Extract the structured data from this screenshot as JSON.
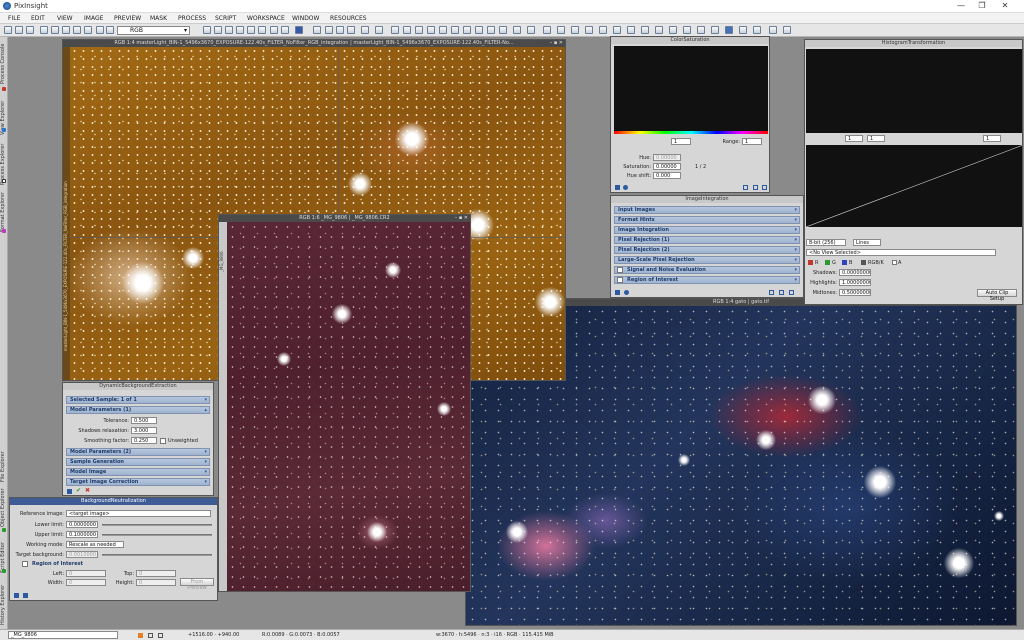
{
  "app": {
    "title": "PixInsight"
  },
  "window_controls": {
    "minimize": "—",
    "maximize": "❐",
    "close": "✕"
  },
  "menu": [
    "FILE",
    "EDIT",
    "VIEW",
    "IMAGE",
    "PREVIEW",
    "MASK",
    "PROCESS",
    "SCRIPT",
    "WORKSPACE",
    "WINDOW",
    "RESOURCES"
  ],
  "toolbar": {
    "rgb_mode": "RGB"
  },
  "side_tabs": [
    "Process Console",
    "View Explorer",
    "Process Explorer",
    "Format Explorer",
    "File Explorer",
    "Object Explorer",
    "Script Editor",
    "History Explorer"
  ],
  "windows": {
    "master": {
      "title": "RGB 1:4 masterLight_BIN-1_5496x3670_EXPOSURE-122.40s_FILTER_NoFilter_RGB_integration | masterLight_BIN-1_5496x3670_EXPOSURE-122.40s_FILTER-No...",
      "side_label": "masterLight_BIN-1_5496x3670_EXPOSURE-122.40s_FILTER_NoFilter_RGB_integration"
    },
    "mg": {
      "title": "RGB 1:6 _MG_9806 | _MG_9806.CR2",
      "side_label": "_MG_9806"
    },
    "gato": {
      "title": "RGB 1:4 gato | gato.tif",
      "side_label": "gato"
    }
  },
  "color_saturation": {
    "title": "ColorSaturation",
    "zoom": "1",
    "range_label": "Range:",
    "range_value": "1",
    "hue_label": "Hue:",
    "hue_value": "0.00000",
    "saturation_label": "Saturation:",
    "saturation_value": "0.00000",
    "page": "1 / 2",
    "hue_shift_label": "Hue shift:",
    "hue_shift_value": "0.000"
  },
  "histogram": {
    "title": "HistogramTransformation",
    "zoom1": "1",
    "zoom2": "1",
    "zoom3": "1",
    "bits": "8-bit (256)",
    "mode": "Lines",
    "view": "<No View Selected>",
    "channels": [
      "R",
      "G",
      "B",
      "RGB/K",
      "A"
    ],
    "shadows_label": "Shadows:",
    "shadows_value": "0.00000000",
    "highlights_label": "Highlights:",
    "highlights_value": "1.00000000",
    "midtones_label": "Midtones:",
    "midtones_value": "0.50000000",
    "auto_clip": "Auto Clip Setup"
  },
  "image_integration": {
    "title": "ImageIntegration",
    "sections": [
      "Input Images",
      "Format Hints",
      "Image Integration",
      "Pixel Rejection (1)",
      "Pixel Rejection (2)",
      "Large-Scale Pixel Rejection",
      "Signal and Noise Evaluation",
      "Region of Interest"
    ]
  },
  "dbe": {
    "title": "DynamicBackgroundExtraction",
    "sections_top": [
      "Selected Sample: 1 of 1",
      "Model Parameters (1)"
    ],
    "tolerance_label": "Tolerance:",
    "tolerance_value": "0.500",
    "shadows_relax_label": "Shadows relaxation:",
    "shadows_relax_value": "3.000",
    "smoothing_label": "Smoothing factor:",
    "smoothing_value": "0.250",
    "unweighted_label": "Unweighted",
    "sections_bottom": [
      "Model Parameters (2)",
      "Sample Generation",
      "Model Image",
      "Target Image Correction"
    ]
  },
  "bn": {
    "title": "BackgroundNeutralization",
    "ref_label": "Reference image:",
    "ref_value": "<target image>",
    "lower_label": "Lower limit:",
    "lower_value": "0.0000000",
    "upper_label": "Upper limit:",
    "upper_value": "0.1000000",
    "mode_label": "Working mode:",
    "mode_value": "Rescale as needed",
    "target_bg_label": "Target background:",
    "target_bg_value": "0.0010000",
    "roi_label": "Region of Interest",
    "left_label": "Left:",
    "left_value": "0",
    "top_label": "Top:",
    "top_value": "0",
    "width_label": "Width:",
    "width_value": "0",
    "height_label": "Height:",
    "height_value": "0",
    "from_preview": "From Preview"
  },
  "status": {
    "view": "_MG_9806",
    "coords": "+1516.00 · +940.00",
    "rgb_vals": "R:0.0089 · G:0.0073 · B:0.0057",
    "info": "w:3670 · h:5496 · n:3 · i16 · RGB · 115.415 MiB"
  },
  "colors": {
    "workspace": "#8a8a8a",
    "panel_header": "#9fb3d0",
    "accent": "#2b5aa0"
  }
}
